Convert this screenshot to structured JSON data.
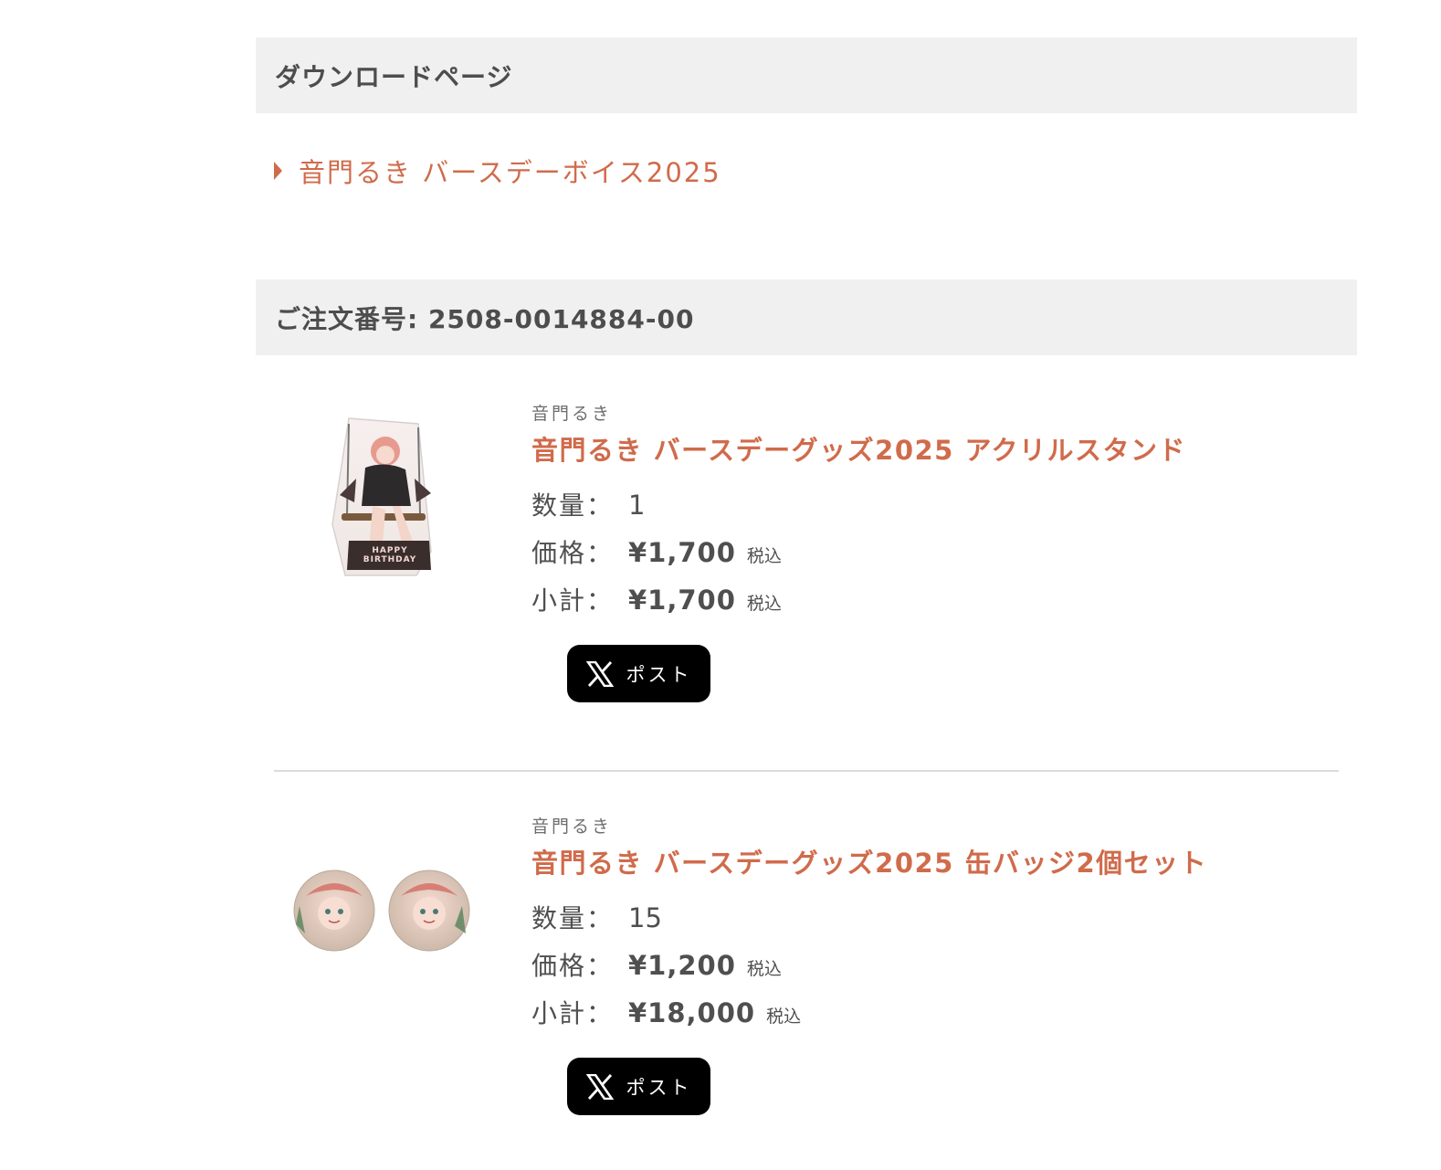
{
  "download_section": {
    "header": "ダウンロードページ",
    "link_label": "音門るき バースデーボイス2025"
  },
  "order": {
    "header": "ご注文番号: 2508-0014884-00"
  },
  "labels": {
    "quantity": "数量：",
    "price": "価格：",
    "subtotal": "小計：",
    "tax_note": "税込",
    "post_button": "ポスト"
  },
  "items": [
    {
      "brand": "音門るき",
      "title": "音門るき バースデーグッズ2025 アクリルスタンド",
      "quantity": "1",
      "price": "¥1,700",
      "subtotal": "¥1,700",
      "image_text": "HAPPY BIRTHDAY"
    },
    {
      "brand": "音門るき",
      "title": "音門るき バースデーグッズ2025 缶バッジ2個セット",
      "quantity": "15",
      "price": "¥1,200",
      "subtotal": "¥18,000"
    }
  ],
  "colors": {
    "accent": "#d06b4b",
    "header_bg": "#f0f0f0",
    "text": "#4f4f4f",
    "button_bg": "#000000"
  },
  "icons": {
    "download_caret": "caret-right-icon",
    "post": "x-logo-icon"
  }
}
